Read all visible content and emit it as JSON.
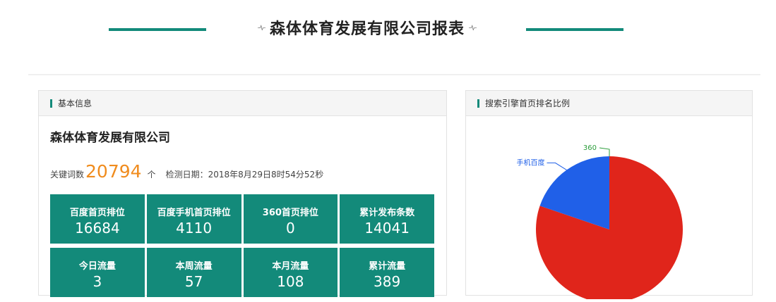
{
  "header": {
    "title": "森体体育发展有限公司报表"
  },
  "basic_info": {
    "panel_title": "基本信息",
    "company_name": "森体体育发展有限公司",
    "keyword_label": "关键词数",
    "keyword_count": "20794",
    "keyword_unit": "个",
    "check_label": "检测日期：",
    "check_time": "2018年8月29日8时54分52秒",
    "stats": [
      {
        "label": "百度首页排位",
        "value": "16684"
      },
      {
        "label": "百度手机首页排位",
        "value": "4110"
      },
      {
        "label": "360首页排位",
        "value": "0"
      },
      {
        "label": "累计发布条数",
        "value": "14041"
      },
      {
        "label": "今日流量",
        "value": "3"
      },
      {
        "label": "本周流量",
        "value": "57"
      },
      {
        "label": "本月流量",
        "value": "108"
      },
      {
        "label": "累计流量",
        "value": "389"
      }
    ]
  },
  "search_ratio": {
    "panel_title": "搜索引擎首页排名比例"
  },
  "chart_data": {
    "type": "pie",
    "series": [
      {
        "name": "百度首页排位",
        "value": 16684,
        "color": "#e0251b"
      },
      {
        "name": "手机百度",
        "value": 4110,
        "color": "#2060e8"
      },
      {
        "name": "360",
        "value": 0,
        "color": "#2a9c3a"
      }
    ],
    "labels": [
      "360",
      "手机百度"
    ]
  },
  "colors": {
    "accent": "#138a7a",
    "highlight": "#f08c1e"
  }
}
